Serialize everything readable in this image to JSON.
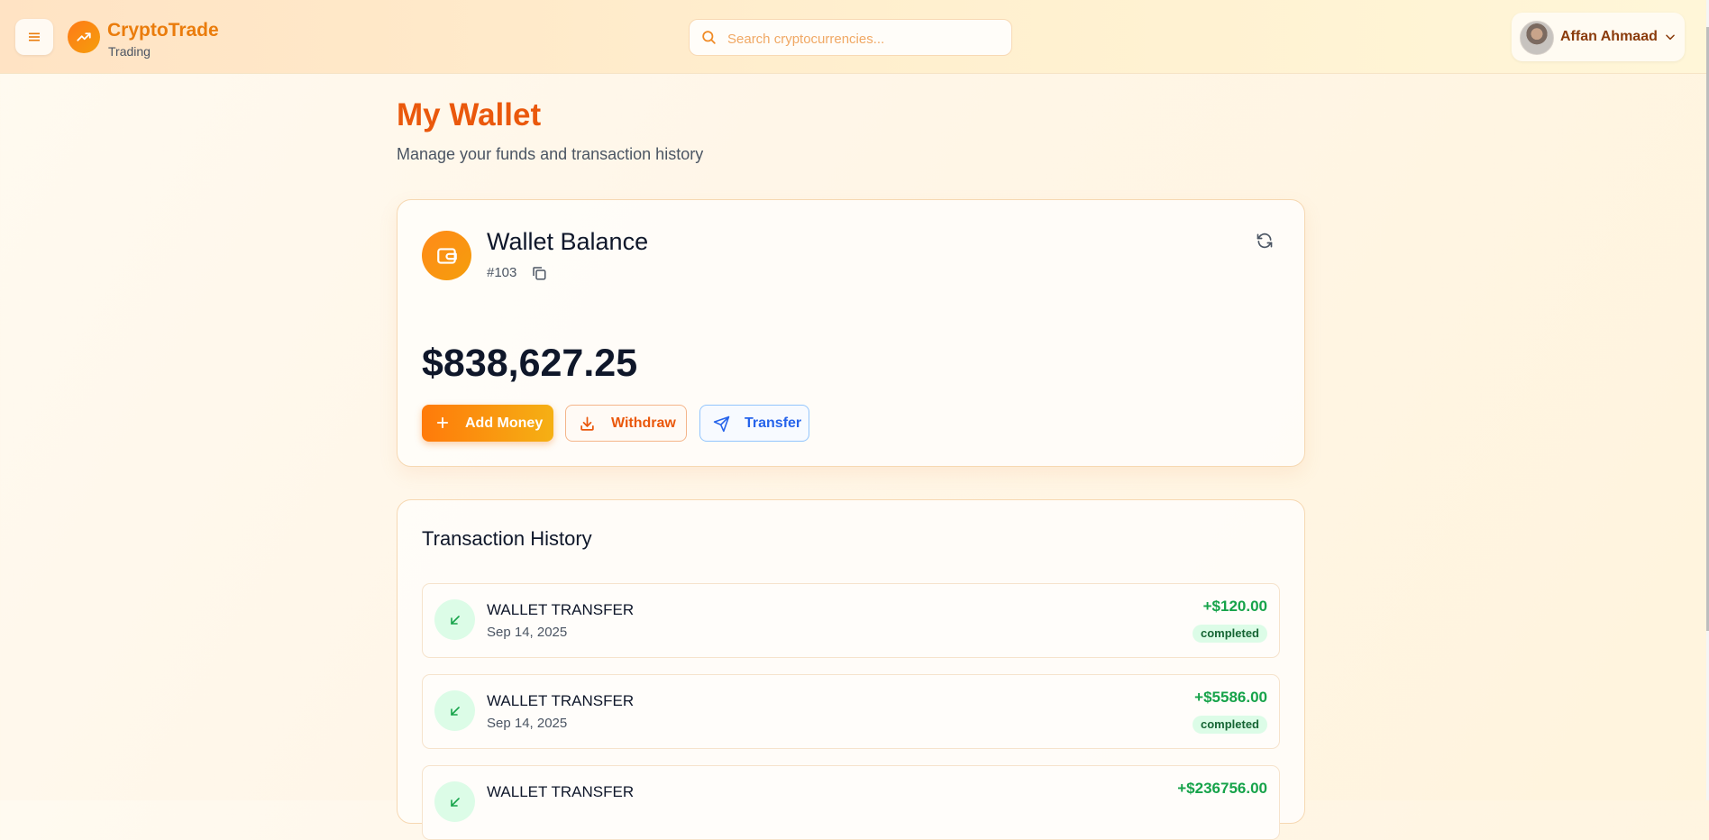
{
  "header": {
    "brand_name": "CryptoTrade",
    "brand_sub": "Trading",
    "search_placeholder": "Search cryptocurrencies...",
    "user_name": "Affan Ahmaad",
    "icons": {
      "menu": "menu-icon",
      "logo": "trending-up-icon",
      "search": "search-icon",
      "chevron": "chevron-down-icon"
    }
  },
  "page": {
    "title": "My Wallet",
    "subtitle": "Manage your funds and transaction history"
  },
  "wallet": {
    "title": "Wallet Balance",
    "id": "#103",
    "balance": "$838,627.25",
    "actions": {
      "add": "Add Money",
      "withdraw": "Withdraw",
      "transfer": "Transfer"
    }
  },
  "history": {
    "title": "Transaction History",
    "items": [
      {
        "type": "WALLET TRANSFER",
        "date": "Sep 14, 2025",
        "amount": "+$120.00",
        "status": "completed"
      },
      {
        "type": "WALLET TRANSFER",
        "date": "Sep 14, 2025",
        "amount": "+$5586.00",
        "status": "completed"
      },
      {
        "type": "WALLET TRANSFER",
        "date": "",
        "amount": "+$236756.00",
        "status": ""
      }
    ]
  },
  "colors": {
    "accent": "#ea580c",
    "brand": "#ea7c0c",
    "success": "#16a34a",
    "transfer": "#2563eb"
  }
}
